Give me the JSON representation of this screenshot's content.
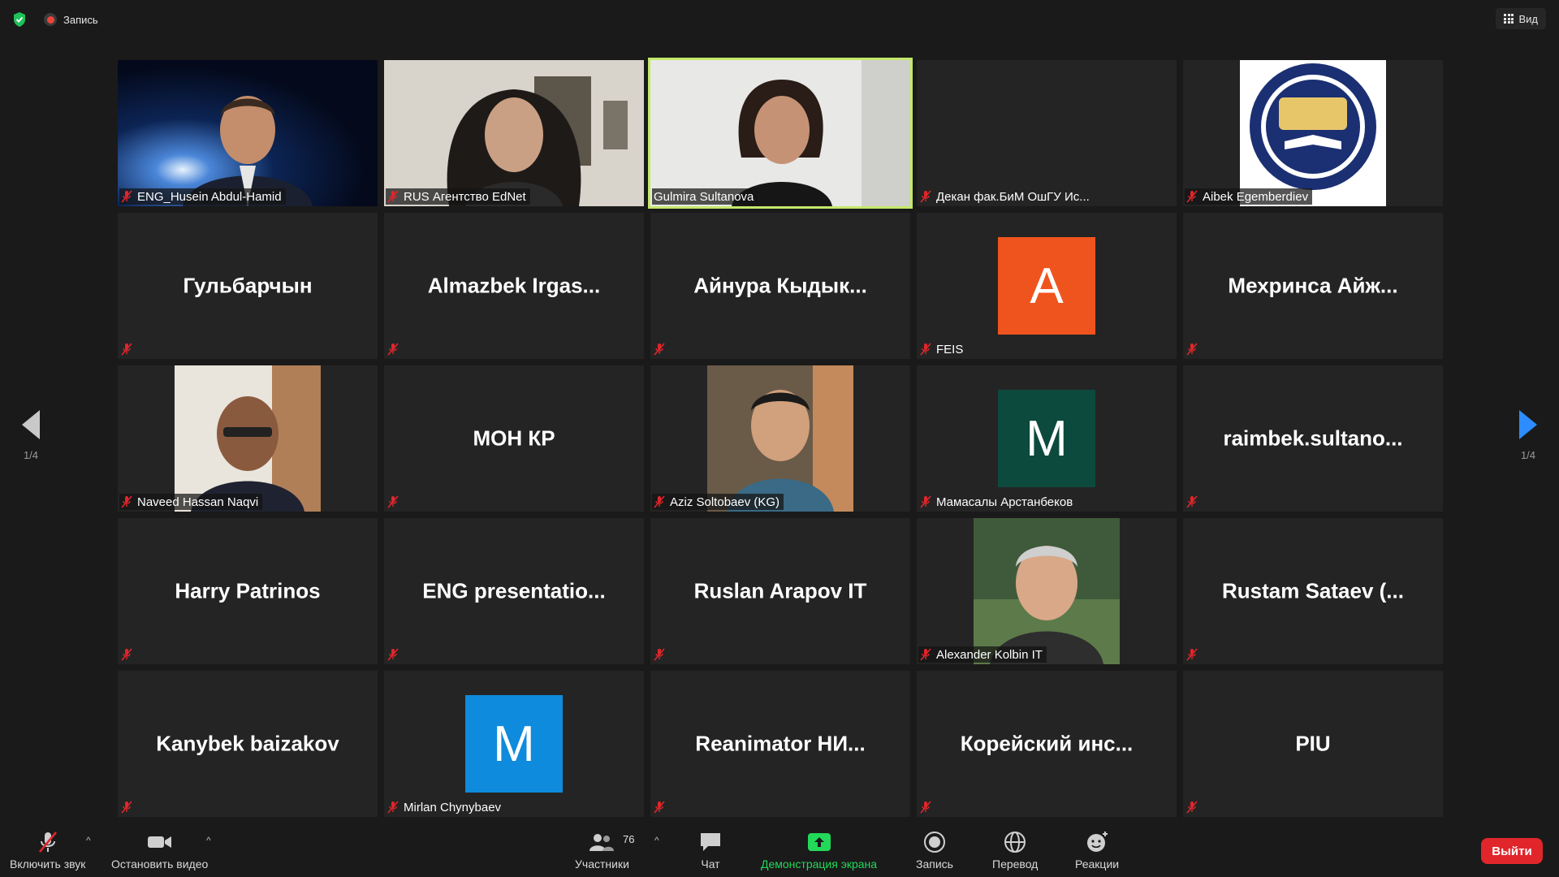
{
  "topbar": {
    "recording_label": "Запись",
    "view_label": "Вид"
  },
  "pagination": {
    "left_page": "1/4",
    "right_page": "1/4"
  },
  "tiles": [
    {
      "name": "ENG_Husein Abdul-Hamid",
      "display": "",
      "kind": "photo"
    },
    {
      "name": "RUS Агентство EdNet",
      "display": "",
      "kind": "photo"
    },
    {
      "name": "Gulmira Sultanova",
      "display": "",
      "kind": "photo",
      "speaking": true
    },
    {
      "name": "Декан фак.БиМ ОшГУ Ис...",
      "display": "",
      "kind": "blank"
    },
    {
      "name": "Aibek Egemberdiev",
      "display": "",
      "kind": "logo"
    },
    {
      "name": "",
      "display": "Гульбарчын",
      "kind": "name"
    },
    {
      "name": "",
      "display": "Almazbek  Irgas...",
      "kind": "name"
    },
    {
      "name": "",
      "display": "Айнура  Кыдык...",
      "kind": "name"
    },
    {
      "name": "FEIS",
      "display": "A",
      "kind": "avatar",
      "color": "#f0541e"
    },
    {
      "name": "",
      "display": "Мехринса  Айж...",
      "kind": "name"
    },
    {
      "name": "Naveed Hassan Naqvi",
      "display": "",
      "kind": "photo"
    },
    {
      "name": "",
      "display": "МОН КР",
      "kind": "name"
    },
    {
      "name": "Aziz Soltobaev (KG)",
      "display": "",
      "kind": "photo"
    },
    {
      "name": "Мамасалы Арстанбеков",
      "display": "M",
      "kind": "avatar",
      "color": "#0c4a3e"
    },
    {
      "name": "",
      "display": "raimbek.sultano...",
      "kind": "name"
    },
    {
      "name": "",
      "display": "Harry Patrinos",
      "kind": "name"
    },
    {
      "name": "",
      "display": "ENG  presentatio...",
      "kind": "name"
    },
    {
      "name": "",
      "display": "Ruslan Arapov IT",
      "kind": "name"
    },
    {
      "name": "Alexander Kolbin IT",
      "display": "",
      "kind": "photo"
    },
    {
      "name": "",
      "display": "Rustam  Sataev  (...",
      "kind": "name"
    },
    {
      "name": "",
      "display": "Kanybek baizakov",
      "kind": "name"
    },
    {
      "name": "Mirlan  Chynybaev",
      "display": "M",
      "kind": "avatar",
      "color": "#0e8bdc"
    },
    {
      "name": "",
      "display": "Reanimator  НИ...",
      "kind": "name"
    },
    {
      "name": "",
      "display": "Корейский  инс...",
      "kind": "name"
    },
    {
      "name": "",
      "display": "PIU",
      "kind": "name"
    }
  ],
  "toolbar": {
    "unmute_label": "Включить звук",
    "stop_video_label": "Остановить видео",
    "participants_label": "Участники",
    "participants_count": "76",
    "chat_label": "Чат",
    "share_label": "Демонстрация экрана",
    "record_label": "Запись",
    "translate_label": "Перевод",
    "reactions_label": "Реакции",
    "leave_label": "Выйти"
  }
}
